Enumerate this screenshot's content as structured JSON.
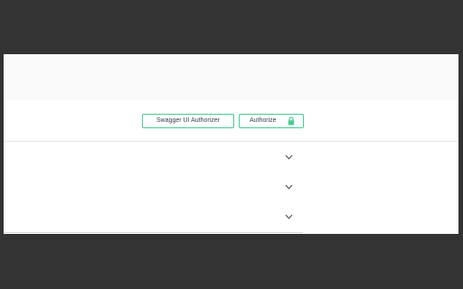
{
  "auth_bar": {
    "swagger_button_label": "Swagger UI Authorizer",
    "authorize_button_label": "Authorize"
  },
  "colors": {
    "accent": "#49cc90",
    "backdrop": "#333333",
    "header_bg": "#fafafa",
    "text": "#3b4151",
    "chevron": "#555555"
  },
  "icons": {
    "lock": "lock-icon",
    "expand": "chevron-down-icon"
  },
  "sections": [
    {
      "expanded": false
    },
    {
      "expanded": false
    },
    {
      "expanded": false
    }
  ]
}
